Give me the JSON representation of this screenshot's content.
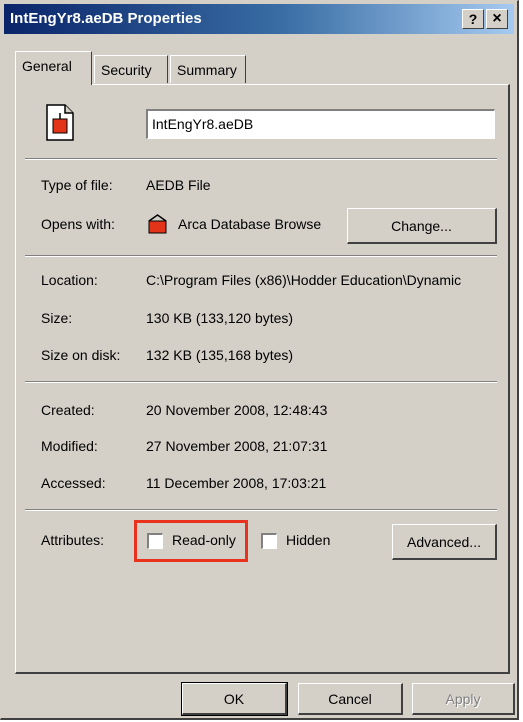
{
  "window": {
    "title": "IntEngYr8.aeDB Properties",
    "help_label": "?",
    "close_label": "×"
  },
  "tabs": [
    {
      "label": "General",
      "active": true
    },
    {
      "label": "Security",
      "active": false
    },
    {
      "label": "Summary",
      "active": false
    }
  ],
  "general": {
    "file_icon": "file-icon",
    "file_name": "IntEngYr8.aeDB",
    "type_label": "Type of file:",
    "type_value": "AEDB File",
    "opens_label": "Opens with:",
    "opens_icon": "app-icon",
    "opens_value": "Arca Database Browse",
    "change_label": "Change...",
    "location_label": "Location:",
    "location_value": "C:\\Program Files (x86)\\Hodder Education\\Dynamic",
    "size_label": "Size:",
    "size_value": "130 KB (133,120 bytes)",
    "size_disk_label": "Size on disk:",
    "size_disk_value": "132 KB (135,168 bytes)",
    "created_label": "Created:",
    "created_value": "20 November 2008, 12:48:43",
    "modified_label": "Modified:",
    "modified_value": "27 November 2008, 21:07:31",
    "accessed_label": "Accessed:",
    "accessed_value": "11 December 2008, 17:03:21",
    "attributes_label": "Attributes:",
    "readonly_label": "Read-only",
    "readonly_checked": false,
    "hidden_label": "Hidden",
    "hidden_checked": false,
    "advanced_label": "Advanced..."
  },
  "footer": {
    "ok_label": "OK",
    "cancel_label": "Cancel",
    "apply_label": "Apply"
  },
  "colors": {
    "highlight": "#e8321e",
    "titlebar_start": "#0a246a",
    "face": "#d4d0c8"
  }
}
